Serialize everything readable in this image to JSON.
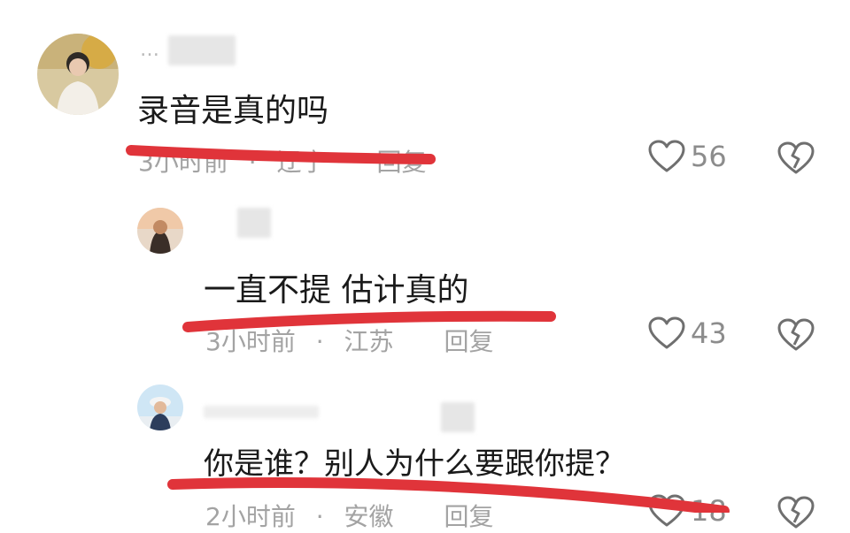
{
  "comments": [
    {
      "username": "…",
      "text": "录音是真的吗",
      "time": "3小时前",
      "location": "辽宁",
      "reply_label": "回复",
      "likes": "56"
    },
    {
      "username": "",
      "text": "一直不提 估计真的",
      "time": "3小时前",
      "location": "江苏",
      "reply_label": "回复",
      "likes": "43"
    },
    {
      "username": "",
      "text": "你是谁？别人为什么要跟你提？",
      "time": "2小时前",
      "location": "安徽",
      "reply_label": "回复",
      "likes": "18"
    }
  ],
  "icons": {
    "like": "heart-outline-icon",
    "dislike": "broken-heart-icon"
  },
  "colors": {
    "annotation": "#e0343a",
    "meta_text": "#a3a3a3",
    "body_text": "#1a1a1a"
  }
}
